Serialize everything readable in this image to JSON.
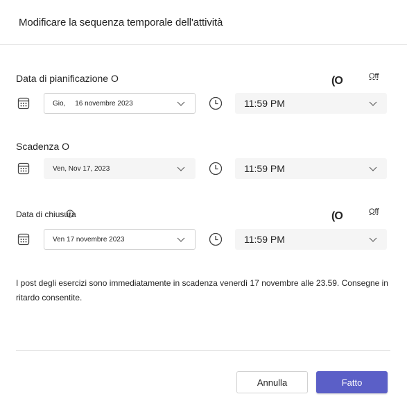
{
  "dialog": {
    "title": "Modificare la sequenza temporale dell'attività"
  },
  "schedule": {
    "label": "Data di pianificazione O",
    "toggle_knob": "(O",
    "toggle_state": "Off",
    "date_value": "Gio,     16 novembre 2023",
    "time_value": "11:59 PM"
  },
  "due": {
    "label": "Scadenza O",
    "date_value": "Ven, Nov 17, 2023",
    "time_value": "11:59 PM"
  },
  "close": {
    "label": "Data di chiusura",
    "toggle_knob": "(O",
    "toggle_state": "Off",
    "date_value": "Ven 17 novembre 2023",
    "time_value": "11:59 PM"
  },
  "summary": "I post degli esercizi sono immediatamente in scadenza venerdì 17 novembre alle 23.59. Consegne in ritardo consentite.",
  "footer": {
    "cancel_label": "Annulla",
    "done_label": "Fatto"
  },
  "colors": {
    "primary": "#5b5fc7",
    "field_fill": "#f5f5f5",
    "text": "#242424"
  },
  "icons": {
    "date": "calendar-icon",
    "time": "clock-icon",
    "dropdown": "chevron-down-icon",
    "info": "info-icon"
  }
}
